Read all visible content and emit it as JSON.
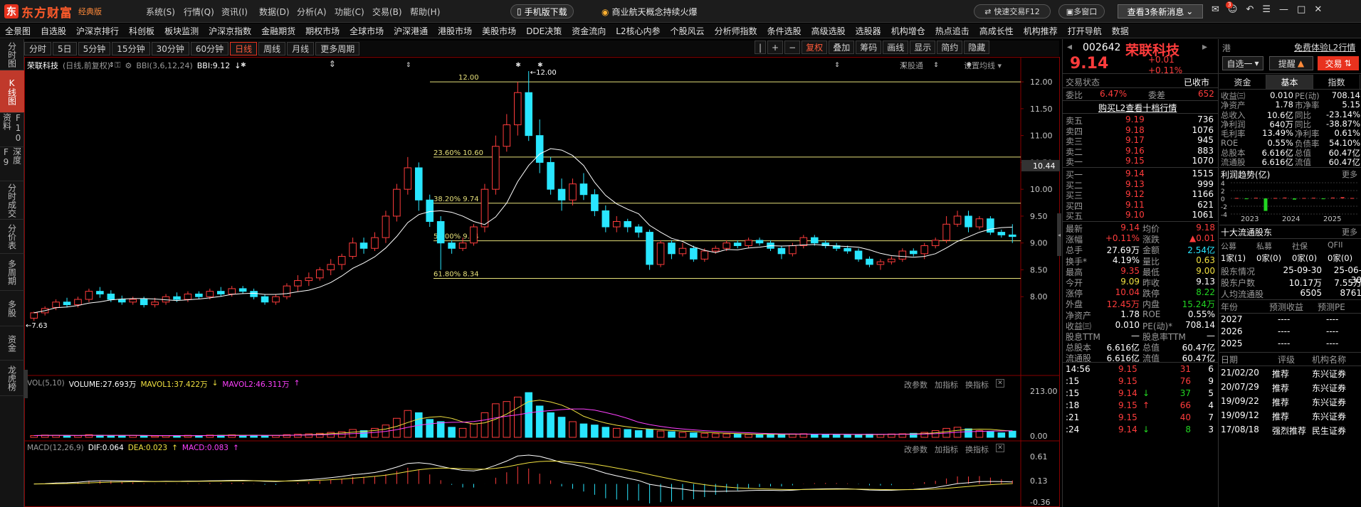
{
  "app": {
    "brand": "东方财富",
    "edition": "经典版",
    "menu": [
      "系统(S)",
      "行情(Q)",
      "资讯(I)",
      "数据(D)",
      "分析(A)",
      "功能(C)",
      "交易(B)",
      "帮助(H)"
    ],
    "promo_app": "手机版下载",
    "promo_news": "商业航天概念持续火爆",
    "quick_trade": "快速交易F12",
    "multi_window": "多窗口",
    "news_button": "查看3条新消息",
    "mail_count": "3"
  },
  "nav": [
    "全景图",
    "自选股",
    "沪深京排行",
    "科创板",
    "板块监测",
    "沪深京指数",
    "金融期货",
    "期权市场",
    "全球市场",
    "沪深港通",
    "港股市场",
    "美股市场",
    "DDE决策",
    "资金流向",
    "L2核心内参",
    "个股风云",
    "分析师指数",
    "条件选股",
    "高级选股",
    "选股器",
    "机构增仓",
    "热点追击",
    "高成长性",
    "机构推荐",
    "打开导航",
    "数据"
  ],
  "leftbar": [
    "分时图",
    "K线图",
    "F10资料",
    "深度F9",
    "分时成交",
    "分价表",
    "多周期",
    "多股",
    "资金",
    "龙虎榜"
  ],
  "periods": [
    "分时",
    "5日",
    "5分钟",
    "15分钟",
    "30分钟",
    "60分钟",
    "日线",
    "周线",
    "月线",
    "更多周期"
  ],
  "active_period": "日线",
  "tools": [
    "|",
    "+",
    "−",
    "复权",
    "叠加",
    "筹码",
    "画线",
    "显示",
    "简约",
    "隐藏"
  ],
  "chart_header": {
    "name": "荣联科技",
    "mode": "(日线,前复权)",
    "indicator": "BBI(3,6,12,24)",
    "indicator_value": "BBI:9.12",
    "deep": "深股通",
    "settings": "设置均线"
  },
  "vol_header": {
    "label": "VOL(5,10)",
    "volume": "VOLUME:27.693万",
    "mavol1": "MAVOL1:37.422万",
    "mavol2": "MAVOL2:46.311万"
  },
  "macd_header": {
    "label": "MACD(12,26,9)",
    "dif": "DIF:0.064",
    "dea": "DEA:0.023",
    "macd": "MACD:0.083"
  },
  "pane_actions": [
    "改参数",
    "加指标",
    "换指标"
  ],
  "chart_data": {
    "type": "candlestick",
    "price_axis": [
      "12.00",
      "11.50",
      "11.00",
      "10.50",
      "10.00",
      "9.50",
      "9.00",
      "8.50",
      "8.00"
    ],
    "price_range": [
      7.5,
      12.2
    ],
    "crosshair_value": "10.44",
    "low_label": "7.63",
    "high_label": "12.00",
    "fib_levels": [
      {
        "label": "12.00",
        "value": 12.0
      },
      {
        "label": "23.60% 10.60",
        "value": 10.6
      },
      {
        "label": "38.20% 9.74",
        "value": 9.74
      },
      {
        "label": "50.00% 9.04",
        "value": 9.04
      },
      {
        "label": "61.80% 8.34",
        "value": 8.34
      }
    ],
    "vol_axis": [
      "213.00",
      "0.00"
    ],
    "macd_axis": [
      "0.61",
      "0.13",
      "-0.36"
    ],
    "candles": [
      [
        7.6,
        7.7,
        7.55,
        7.72
      ],
      [
        7.7,
        7.78,
        7.65,
        7.82
      ],
      [
        7.8,
        7.9,
        7.75,
        7.95
      ],
      [
        7.9,
        7.85,
        7.8,
        7.98
      ],
      [
        7.85,
        7.95,
        7.8,
        8.0
      ],
      [
        7.95,
        8.1,
        7.9,
        8.15
      ],
      [
        8.1,
        8.05,
        7.98,
        8.18
      ],
      [
        8.05,
        7.95,
        7.9,
        8.12
      ],
      [
        7.95,
        7.9,
        7.85,
        8.02
      ],
      [
        7.9,
        7.95,
        7.85,
        8.0
      ],
      [
        7.95,
        7.85,
        7.8,
        8.0
      ],
      [
        7.85,
        7.9,
        7.8,
        7.98
      ],
      [
        7.9,
        8.0,
        7.85,
        8.05
      ],
      [
        8.0,
        7.95,
        7.9,
        8.08
      ],
      [
        7.95,
        8.05,
        7.9,
        8.1
      ],
      [
        8.05,
        8.0,
        7.95,
        8.1
      ],
      [
        8.0,
        8.1,
        7.95,
        8.15
      ],
      [
        8.1,
        8.05,
        8.0,
        8.18
      ],
      [
        8.05,
        8.15,
        8.0,
        8.2
      ],
      [
        8.15,
        8.1,
        8.05,
        8.2
      ],
      [
        8.1,
        8.0,
        7.95,
        8.15
      ],
      [
        8.0,
        7.9,
        7.85,
        8.05
      ],
      [
        7.9,
        8.0,
        7.85,
        8.05
      ],
      [
        8.0,
        8.2,
        7.95,
        8.25
      ],
      [
        8.2,
        8.3,
        8.1,
        8.4
      ],
      [
        8.3,
        8.35,
        8.2,
        8.45
      ],
      [
        8.35,
        8.5,
        8.3,
        8.55
      ],
      [
        8.5,
        8.6,
        8.4,
        8.7
      ],
      [
        8.6,
        8.75,
        8.5,
        8.8
      ],
      [
        8.75,
        9.0,
        8.7,
        9.1
      ],
      [
        9.0,
        8.9,
        8.8,
        9.1
      ],
      [
        8.9,
        9.1,
        8.85,
        9.2
      ],
      [
        9.1,
        9.5,
        9.0,
        9.6
      ],
      [
        9.5,
        10.0,
        9.4,
        10.1
      ],
      [
        10.0,
        10.4,
        9.9,
        10.6
      ],
      [
        10.4,
        9.8,
        9.6,
        10.5
      ],
      [
        9.8,
        9.4,
        9.3,
        9.9
      ],
      [
        9.4,
        9.0,
        8.5,
        9.5
      ],
      [
        9.0,
        8.9,
        8.8,
        9.05
      ],
      [
        8.9,
        9.0,
        8.85,
        9.1
      ],
      [
        9.0,
        9.3,
        8.95,
        9.35
      ],
      [
        9.3,
        10.0,
        9.2,
        10.1
      ],
      [
        10.0,
        10.8,
        9.9,
        11.0
      ],
      [
        10.8,
        11.2,
        10.7,
        11.4
      ],
      [
        11.2,
        11.8,
        11.0,
        12.0
      ],
      [
        11.8,
        11.0,
        10.9,
        12.2
      ],
      [
        11.0,
        10.5,
        10.3,
        11.3
      ],
      [
        10.5,
        10.0,
        9.9,
        10.6
      ],
      [
        10.0,
        9.8,
        9.6,
        10.2
      ],
      [
        9.8,
        10.1,
        9.7,
        10.2
      ],
      [
        10.1,
        9.9,
        9.8,
        10.3
      ],
      [
        9.9,
        9.6,
        9.5,
        10.0
      ],
      [
        9.6,
        9.3,
        9.2,
        9.7
      ],
      [
        9.3,
        9.4,
        9.2,
        9.5
      ],
      [
        9.4,
        9.3,
        9.2,
        9.45
      ],
      [
        9.3,
        9.2,
        9.1,
        9.35
      ],
      [
        9.2,
        8.6,
        8.5,
        9.25
      ],
      [
        8.6,
        9.0,
        8.55,
        9.05
      ],
      [
        9.0,
        8.8,
        8.7,
        9.05
      ],
      [
        8.8,
        8.9,
        8.75,
        9.0
      ],
      [
        8.9,
        8.7,
        8.65,
        8.95
      ],
      [
        8.7,
        8.85,
        8.65,
        8.9
      ],
      [
        8.85,
        8.9,
        8.8,
        8.95
      ],
      [
        8.9,
        9.0,
        8.85,
        9.05
      ],
      [
        9.0,
        8.95,
        8.9,
        9.05
      ],
      [
        8.95,
        9.05,
        8.9,
        9.1
      ],
      [
        9.05,
        9.0,
        8.95,
        9.1
      ],
      [
        9.0,
        8.9,
        8.85,
        9.05
      ],
      [
        8.9,
        8.8,
        8.7,
        8.95
      ],
      [
        8.8,
        8.95,
        8.75,
        9.0
      ],
      [
        8.95,
        9.1,
        8.9,
        9.15
      ],
      [
        9.1,
        9.0,
        8.95,
        9.15
      ],
      [
        9.0,
        8.95,
        8.9,
        9.05
      ],
      [
        8.95,
        8.9,
        8.85,
        9.0
      ],
      [
        8.9,
        8.85,
        8.8,
        8.95
      ],
      [
        8.85,
        8.7,
        8.65,
        8.9
      ],
      [
        8.7,
        8.6,
        8.55,
        8.75
      ],
      [
        8.6,
        8.65,
        8.5,
        8.7
      ],
      [
        8.65,
        8.7,
        8.6,
        8.75
      ],
      [
        8.7,
        8.85,
        8.65,
        8.9
      ],
      [
        8.85,
        8.8,
        8.75,
        8.9
      ],
      [
        8.8,
        8.95,
        8.7,
        9.0
      ],
      [
        8.95,
        9.05,
        8.9,
        9.1
      ],
      [
        9.05,
        9.35,
        9.0,
        9.5
      ],
      [
        9.35,
        9.5,
        9.3,
        9.6
      ],
      [
        9.5,
        9.3,
        9.2,
        9.6
      ],
      [
        9.3,
        9.45,
        9.25,
        9.5
      ],
      [
        9.45,
        9.2,
        9.15,
        9.5
      ],
      [
        9.2,
        9.15,
        9.1,
        9.25
      ],
      [
        9.15,
        9.12,
        9.0,
        9.35
      ]
    ],
    "volumes": [
      8,
      10,
      9,
      7,
      8,
      12,
      9,
      8,
      7,
      8,
      7,
      6,
      8,
      7,
      9,
      8,
      10,
      9,
      11,
      8,
      9,
      7,
      8,
      12,
      14,
      16,
      18,
      22,
      25,
      35,
      30,
      40,
      55,
      85,
      120,
      110,
      80,
      70,
      45,
      40,
      60,
      110,
      150,
      160,
      180,
      200,
      140,
      110,
      90,
      70,
      60,
      55,
      45,
      40,
      35,
      30,
      35,
      28,
      25,
      22,
      20,
      18,
      16,
      15,
      14,
      13,
      12,
      14,
      13,
      15,
      16,
      14,
      13,
      12,
      11,
      12,
      14,
      13,
      15,
      16,
      18,
      22,
      30,
      40,
      45,
      38,
      30,
      25,
      20,
      27.7
    ],
    "volume_series": [
      "VOLUME",
      "MAVOL1",
      "MAVOL2"
    ]
  },
  "quote": {
    "code": "002642",
    "name": "荣联科技",
    "tag": "港",
    "free_l2": "免费体验L2行情",
    "price": "9.14",
    "change": "+0.01",
    "change_pct": "+0.11%",
    "watch_btn": "自选一",
    "remind_btn": "提醒",
    "trade_btn": "交易",
    "status_label": "交易状态",
    "status_value": "已收市",
    "webi_label": "委比",
    "webi_value": "6.47%",
    "weicha_label": "委差",
    "weicha_value": "652",
    "buy_l2": "购买L2查看十档行情"
  },
  "order_book": {
    "sells": [
      {
        "label": "卖五",
        "price": "9.19",
        "vol": "736"
      },
      {
        "label": "卖四",
        "price": "9.18",
        "vol": "1076"
      },
      {
        "label": "卖三",
        "price": "9.17",
        "vol": "945"
      },
      {
        "label": "卖二",
        "price": "9.16",
        "vol": "883"
      },
      {
        "label": "卖一",
        "price": "9.15",
        "vol": "1070"
      }
    ],
    "buys": [
      {
        "label": "买一",
        "price": "9.14",
        "vol": "1515"
      },
      {
        "label": "买二",
        "price": "9.13",
        "vol": "999"
      },
      {
        "label": "买三",
        "price": "9.12",
        "vol": "1166"
      },
      {
        "label": "买四",
        "price": "9.11",
        "vol": "621"
      },
      {
        "label": "买五",
        "price": "9.10",
        "vol": "1061"
      }
    ]
  },
  "stats": [
    {
      "l1": "最新",
      "v1": "9.14",
      "c1": "red",
      "l2": "均价",
      "v2": "9.18",
      "c2": "red"
    },
    {
      "l1": "涨幅",
      "v1": "+0.11%",
      "c1": "red",
      "l2": "涨跌",
      "v2": "▲0.01",
      "c2": "red"
    },
    {
      "l1": "总手",
      "v1": "27.69万",
      "c1": "white",
      "l2": "金额",
      "v2": "2.54亿",
      "c2": "cyan"
    },
    {
      "l1": "换手*",
      "v1": "4.19%",
      "c1": "white",
      "l2": "量比",
      "v2": "0.63",
      "c2": "yellow"
    },
    {
      "l1": "最高",
      "v1": "9.35",
      "c1": "red",
      "l2": "最低",
      "v2": "9.00",
      "c2": "yellow"
    },
    {
      "l1": "今开",
      "v1": "9.09",
      "c1": "yellow",
      "l2": "昨收",
      "v2": "9.13",
      "c2": "white"
    },
    {
      "l1": "涨停",
      "v1": "10.04",
      "c1": "red",
      "l2": "跌停",
      "v2": "8.22",
      "c2": "green"
    },
    {
      "l1": "外盘",
      "v1": "12.45万",
      "c1": "red",
      "l2": "内盘",
      "v2": "15.24万",
      "c2": "green"
    },
    {
      "l1": "净资产",
      "v1": "1.78",
      "c1": "white",
      "l2": "ROE",
      "v2": "0.55%",
      "c2": "white"
    },
    {
      "l1": "收益㈢",
      "v1": "0.010",
      "c1": "white",
      "l2": "PE(动)*",
      "v2": "708.14",
      "c2": "white"
    },
    {
      "l1": "股息TTM",
      "v1": "—",
      "c1": "white",
      "l2": "股息率TTM",
      "v2": "—",
      "c2": "white"
    },
    {
      "l1": "总股本",
      "v1": "6.616亿",
      "c1": "white",
      "l2": "总值",
      "v2": "60.47亿",
      "c2": "white"
    },
    {
      "l1": "流通股",
      "v1": "6.616亿",
      "c1": "white",
      "l2": "流值",
      "v2": "60.47亿",
      "c2": "white"
    }
  ],
  "ticks": [
    {
      "time": "14:56",
      "price": "9.15",
      "arrow": "",
      "vol": "31",
      "n": "6"
    },
    {
      "time": ":15",
      "price": "9.15",
      "arrow": "",
      "vol": "76",
      "n": "9"
    },
    {
      "time": ":15",
      "price": "9.14",
      "arrow": "↓",
      "vol": "37",
      "n": "5"
    },
    {
      "time": ":18",
      "price": "9.15",
      "arrow": "↑",
      "vol": "66",
      "n": "4"
    },
    {
      "time": ":21",
      "price": "9.15",
      "arrow": "",
      "vol": "40",
      "n": "7"
    },
    {
      "time": ":24",
      "price": "9.14",
      "arrow": "↓",
      "vol": "8",
      "n": "3"
    }
  ],
  "fin_tabs": [
    "资金",
    "基本",
    "指数"
  ],
  "fin_rows": [
    {
      "l1": "收益㈢",
      "v1": "0.010",
      "l2": "PE(动)",
      "v2": "708.14"
    },
    {
      "l1": "净资产",
      "v1": "1.78",
      "l2": "市净率",
      "v2": "5.15"
    },
    {
      "l1": "总收入",
      "v1": "10.6亿",
      "l2": "同比",
      "v2": "-23.14%"
    },
    {
      "l1": "净利润",
      "v1": "640万",
      "l2": "同比",
      "v2": "-38.87%"
    },
    {
      "l1": "毛利率",
      "v1": "13.49%",
      "l2": "净利率",
      "v2": "0.61%"
    },
    {
      "l1": "ROE",
      "v1": "0.55%",
      "l2": "负债率",
      "v2": "54.10%"
    },
    {
      "l1": "总股本",
      "v1": "6.616亿",
      "l2": "总值",
      "v2": "60.47亿"
    },
    {
      "l1": "流通股",
      "v1": "6.616亿",
      "l2": "流值",
      "v2": "60.47亿"
    }
  ],
  "profit_chart": {
    "title": "利润趋势(亿)",
    "more": "更多",
    "y_ticks": [
      "4",
      "2",
      "0",
      "-2",
      "-4"
    ],
    "x_labels": [
      "2023",
      "2024",
      "2025"
    ],
    "bars": [
      0.1,
      -0.2,
      0.15,
      -3.2,
      0.1,
      0.2,
      -0.3,
      0.1,
      0.15,
      -0.2,
      0.2,
      0.3,
      0.1
    ]
  },
  "holders": {
    "title": "十大流通股东",
    "more": "更多",
    "heads": [
      "公募",
      "私募",
      "社保",
      "QFII"
    ],
    "values": [
      "1家(1)",
      "0家(0)",
      "0家(0)",
      "0家(0)"
    ],
    "rows": [
      {
        "l": "股东情况",
        "a": "25-09-30",
        "b": "25-06-30"
      },
      {
        "l": "股东户数",
        "a": "10.17万",
        "b": "7.55万"
      },
      {
        "l": "人均流通股",
        "a": "6505",
        "b": "8761"
      }
    ]
  },
  "forecast": {
    "heads": [
      "年份",
      "预测收益",
      "预测PE"
    ],
    "rows": [
      {
        "y": "2027",
        "a": "----",
        "b": "----"
      },
      {
        "y": "2026",
        "a": "----",
        "b": "----"
      },
      {
        "y": "2025",
        "a": "----",
        "b": "----"
      }
    ]
  },
  "ratings": {
    "heads": [
      "日期",
      "评级",
      "机构名称"
    ],
    "rows": [
      {
        "d": "21/02/20",
        "r": "推荐",
        "o": "东兴证券"
      },
      {
        "d": "20/07/29",
        "r": "推荐",
        "o": "东兴证券"
      },
      {
        "d": "19/09/22",
        "r": "推荐",
        "o": "东兴证券"
      },
      {
        "d": "19/09/12",
        "r": "推荐",
        "o": "东兴证券"
      },
      {
        "d": "17/08/18",
        "r": "强烈推荐",
        "o": "民生证券"
      }
    ]
  }
}
